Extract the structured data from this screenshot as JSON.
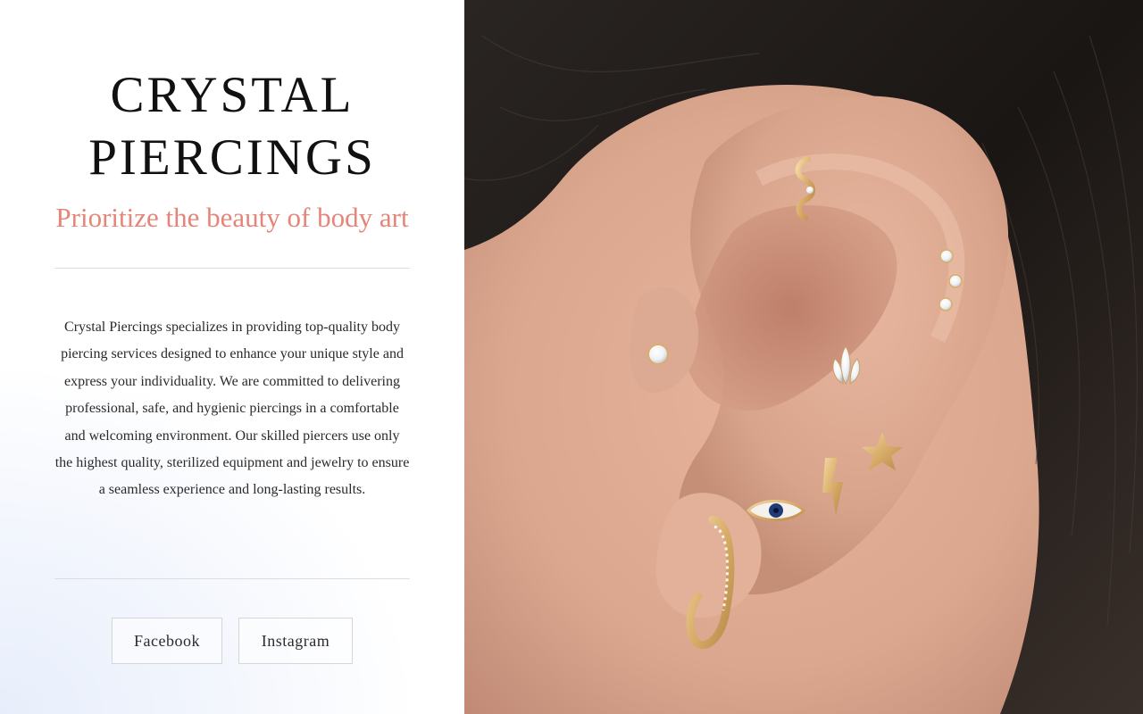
{
  "brand": {
    "title_line1": "CRYSTAL",
    "title_line2": "PIERCINGS",
    "tagline": "Prioritize the beauty of body art",
    "tagline_color": "#e58579"
  },
  "description": "Crystal Piercings specializes in providing top-quality body piercing services designed to enhance your unique style and express your individuality. We are committed to delivering professional, safe, and hygienic piercings in a comfortable and welcoming environment. Our skilled piercers use only the highest quality, sterilized equipment and jewelry to ensure a seamless experience and long-lasting results.",
  "social": {
    "facebook_label": "Facebook",
    "instagram_label": "Instagram"
  },
  "hero_image": {
    "subject": "ear-with-gold-piercings-photo"
  }
}
